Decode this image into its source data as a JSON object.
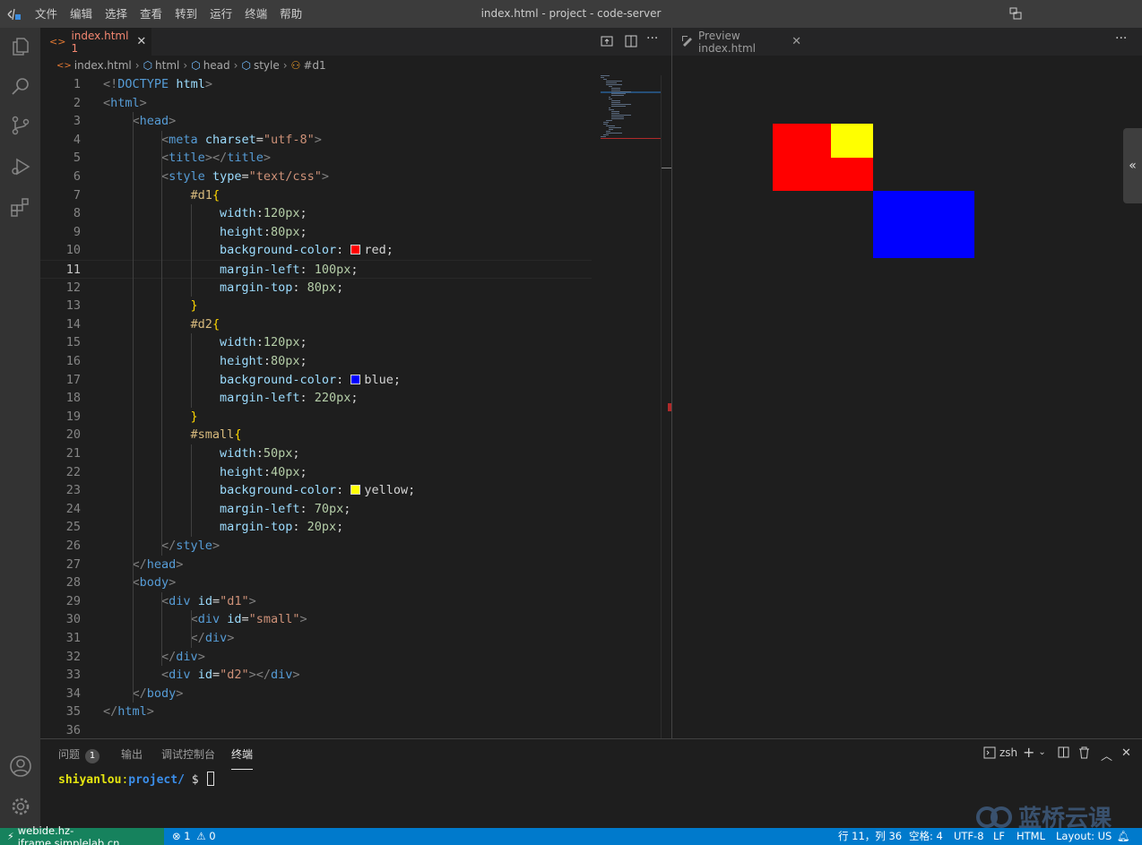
{
  "window": {
    "title": "index.html - project - code-server"
  },
  "menu": [
    "文件",
    "编辑",
    "选择",
    "查看",
    "转到",
    "运行",
    "终端",
    "帮助"
  ],
  "activity_icons": [
    "explorer-icon",
    "search-icon",
    "source-control-icon",
    "run-debug-icon",
    "extensions-icon",
    "account-icon",
    "settings-gear-icon"
  ],
  "editor_tab": {
    "label": "index.html 1",
    "file": "index.html",
    "problems": "1"
  },
  "preview_tab": {
    "label": "Preview index.html"
  },
  "breadcrumbs": [
    "index.html",
    "html",
    "head",
    "style",
    "#d1"
  ],
  "code_lines": [
    "<!DOCTYPE html>",
    "<html>",
    "    <head>",
    "        <meta charset=\"utf-8\">",
    "        <title></title>",
    "        <style type=\"text/css\">",
    "            #d1{",
    "                width:120px;",
    "                height:80px;",
    "                background-color: red;",
    "                margin-left: 100px;",
    "                margin-top: 80px;",
    "            }",
    "            #d2{",
    "                width:120px;",
    "                height:80px;",
    "                background-color: blue;",
    "                margin-left: 220px;",
    "            }",
    "            #small{",
    "                width:50px;",
    "                height:40px;",
    "                background-color: yellow;",
    "                margin-left: 70px;",
    "                margin-top: 20px;",
    "        </style>",
    "    </head>",
    "    <body>",
    "        <div id=\"d1\">",
    "            <div id=\"small\">",
    "            </div>",
    "        </div>",
    "        <div id=\"d2\"></div>",
    "    </body>",
    "</html>",
    ""
  ],
  "current_line": 11,
  "colors": {
    "red": "#ff0000",
    "blue": "#0000ff",
    "yellow": "#ffff00",
    "statusbar": "#007acc",
    "remote": "#16825d"
  },
  "panel": {
    "tabs": [
      "问题",
      "输出",
      "调试控制台",
      "终端"
    ],
    "problems_count": "1",
    "active_tab": "终端",
    "terminal_shell": "zsh",
    "prompt_user": "shiyanlou",
    "prompt_sep": ":",
    "prompt_path": "project/",
    "prompt_symbol": " $ "
  },
  "status": {
    "remote": "webide.hz-iframe.simplelab.cn",
    "errors": "1",
    "warnings": "0",
    "position": "行 11，列 36",
    "spaces": "空格: 4",
    "encoding": "UTF-8",
    "eol": "LF",
    "language": "HTML",
    "layout": "Layout: US"
  },
  "watermark": "蓝桥云课"
}
